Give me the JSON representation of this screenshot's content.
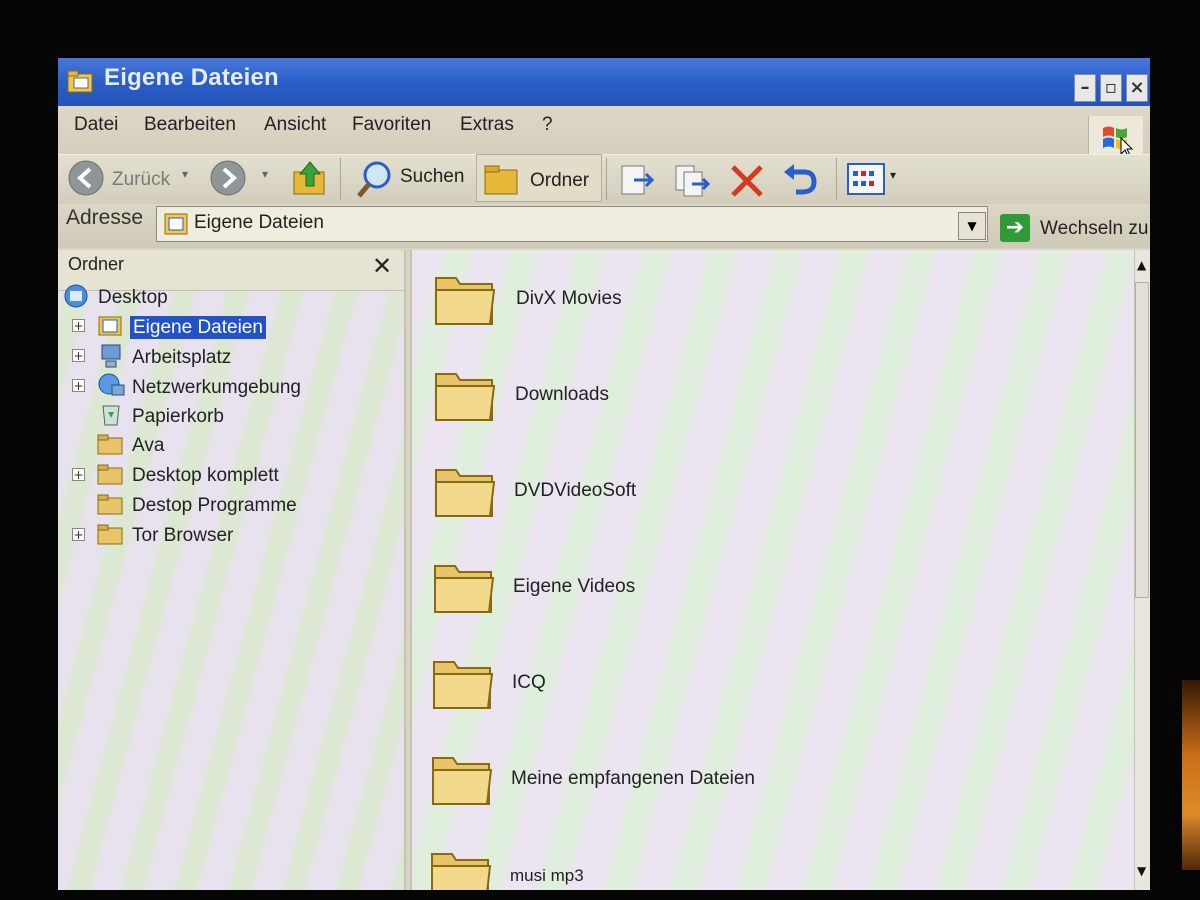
{
  "window": {
    "title": "Eigene Dateien"
  },
  "menu": {
    "items": [
      "Datei",
      "Bearbeiten",
      "Ansicht",
      "Favoriten",
      "Extras",
      "?"
    ]
  },
  "toolbar": {
    "back_label": "Zurück",
    "search_label": "Suchen",
    "folders_label": "Ordner"
  },
  "address": {
    "label": "Adresse",
    "value": "Eigene Dateien",
    "go_label": "Wechseln zu"
  },
  "folder_pane": {
    "title": "Ordner",
    "tree": [
      {
        "label": "Desktop",
        "icon": "desktop-icon"
      },
      {
        "label": "Eigene Dateien",
        "icon": "my-documents-icon",
        "selected": true,
        "expandable": true
      },
      {
        "label": "Arbeitsplatz",
        "icon": "my-computer-icon",
        "expandable": true
      },
      {
        "label": "Netzwerkumgebung",
        "icon": "network-icon",
        "expandable": true
      },
      {
        "label": "Papierkorb",
        "icon": "recycle-bin-icon"
      },
      {
        "label": "Ava",
        "icon": "folder-icon"
      },
      {
        "label": "Desktop komplett",
        "icon": "folder-icon",
        "expandable": true
      },
      {
        "label": "Destop Programme",
        "icon": "folder-icon"
      },
      {
        "label": "Tor Browser",
        "icon": "folder-icon",
        "expandable": true
      }
    ]
  },
  "content": {
    "items": [
      "DivX Movies",
      "Downloads",
      "DVDVideoSoft",
      "Eigene Videos",
      "ICQ",
      "Meine empfangenen Dateien",
      "musi mp3"
    ]
  },
  "colors": {
    "title_bar": "#2a5ec8",
    "selection": "#2352c8",
    "folder": "#e8c56a",
    "delete_red": "#d63a1e"
  }
}
